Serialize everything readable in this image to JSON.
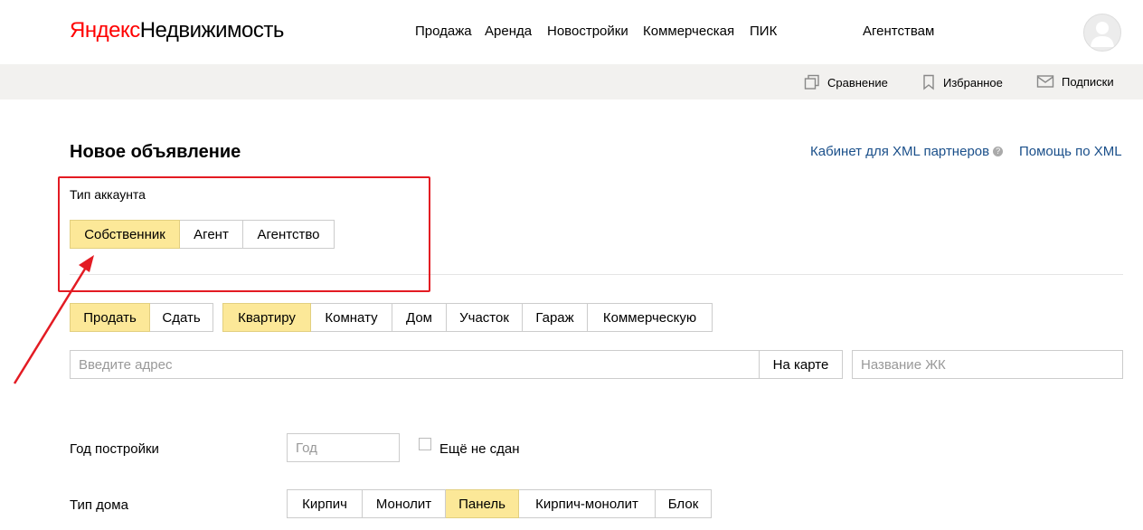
{
  "header": {
    "logo_part1": "Яндекс",
    "logo_part2": "Недвижимость",
    "nav": [
      "Продажа",
      "Аренда",
      "Новостройки",
      "Коммерческая",
      "ПИК",
      "Агентствам"
    ]
  },
  "subbar": {
    "compare": "Сравнение",
    "favorites": "Избранное",
    "subscriptions": "Подписки"
  },
  "page": {
    "title": "Новое объявление",
    "xml_cabinet": "Кабинет для XML партнеров",
    "xml_help": "Помощь по XML"
  },
  "account": {
    "label": "Тип аккаунта",
    "options": [
      "Собственник",
      "Агент",
      "Агентство"
    ],
    "selected": "Собственник"
  },
  "deal": {
    "options": [
      "Продать",
      "Сдать"
    ],
    "selected": "Продать"
  },
  "property": {
    "options": [
      "Квартиру",
      "Комнату",
      "Дом",
      "Участок",
      "Гараж",
      "Коммерческую"
    ],
    "selected": "Квартиру"
  },
  "address": {
    "placeholder": "Введите адрес",
    "map_button": "На карте",
    "complex_placeholder": "Название ЖК"
  },
  "build_year": {
    "label": "Год постройки",
    "placeholder": "Год",
    "not_built_label": "Ещё не сдан",
    "not_built_checked": false
  },
  "house_type": {
    "label": "Тип дома",
    "options": [
      "Кирпич",
      "Монолит",
      "Панель",
      "Кирпич-монолит",
      "Блок"
    ],
    "selected": "Панель"
  },
  "colors": {
    "active_button": "#fce898",
    "annotation": "#e31b23",
    "link": "#1a4f8a"
  }
}
